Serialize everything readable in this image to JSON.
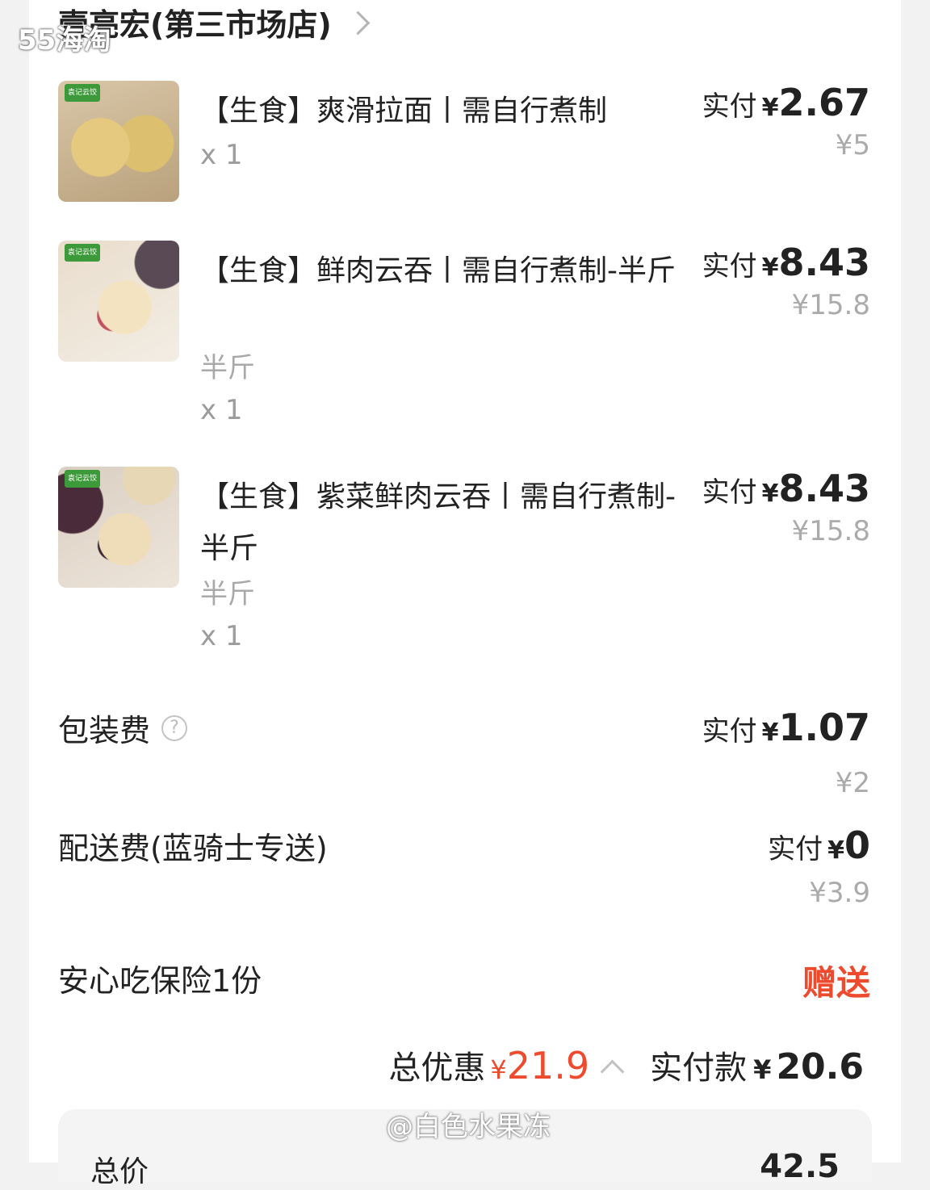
{
  "watermark_top": "55海淘",
  "watermark_bottom": "@白色水果冻",
  "store": {
    "name": "壹亮宏(第三市场店)"
  },
  "items": [
    {
      "title": "【生食】爽滑拉面丨需自行煮制",
      "spec": "",
      "qty": "x 1",
      "pay_label": "实付",
      "yen": "¥",
      "pay_amount": "2.67",
      "original_price": "¥5",
      "brand": "袁记云饺"
    },
    {
      "title": "【生食】鲜肉云吞丨需自行煮制-半斤",
      "spec": "半斤",
      "qty": "x 1",
      "pay_label": "实付",
      "yen": "¥",
      "pay_amount": "8.43",
      "original_price": "¥15.8",
      "brand": "袁记云饺"
    },
    {
      "title": "【生食】紫菜鲜肉云吞丨需自行煮制-半斤",
      "spec": "半斤",
      "qty": "x 1",
      "pay_label": "实付",
      "yen": "¥",
      "pay_amount": "8.43",
      "original_price": "¥15.8",
      "brand": "袁记云饺"
    }
  ],
  "fees": {
    "packaging": {
      "label": "包装费",
      "help_icon": "?",
      "pay_label": "实付",
      "yen": "¥",
      "pay_amount": "1.07",
      "original_price": "¥2"
    },
    "delivery": {
      "label": "配送费(蓝骑士专送)",
      "pay_label": "实付",
      "yen": "¥",
      "pay_amount": "0",
      "original_price": "¥3.9"
    },
    "insurance": {
      "label": "安心吃保险1份",
      "value": "赠送"
    }
  },
  "summary": {
    "discount_label": "总优惠",
    "discount_yen": "¥",
    "discount_amount": "21.9",
    "total_label": "实付款",
    "total_yen": "¥",
    "total_amount": "20.6"
  },
  "bottom_panel": {
    "label": "总价",
    "value": "42.5"
  },
  "colors": {
    "accent_red": "#ee4a2e",
    "text_primary": "#222222",
    "text_muted": "#ababab",
    "background": "#f2f2f2"
  }
}
